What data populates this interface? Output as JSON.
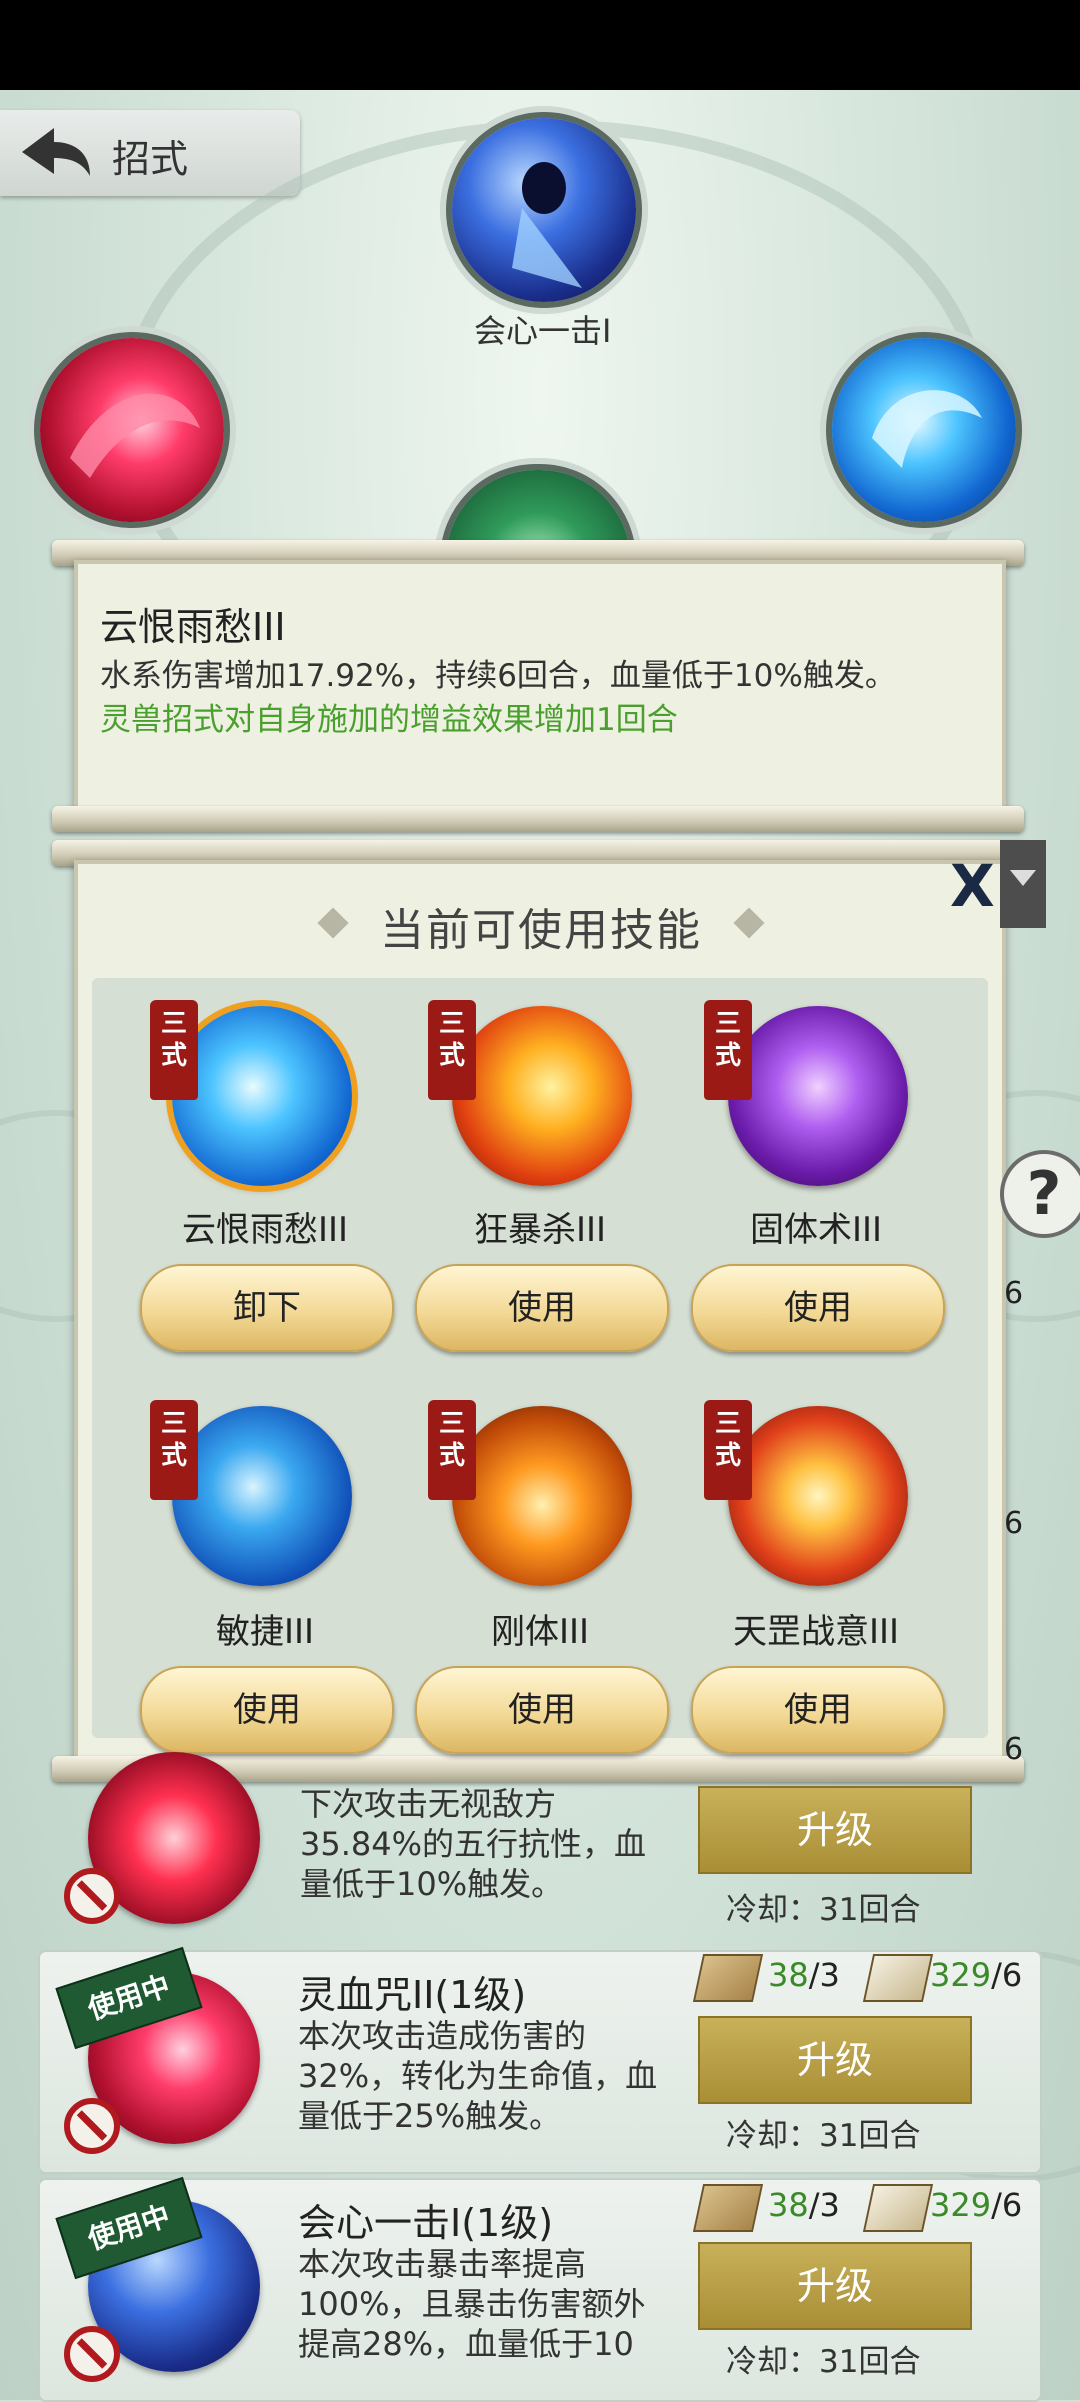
{
  "header": {
    "title": "招式"
  },
  "slots": {
    "top_label": "会心一击I"
  },
  "info": {
    "title": "云恨雨愁III",
    "desc": "水系伤害增加17.92%，持续6回合，血量低于10%触发。",
    "bonus": "灵兽招式对自身施加的增益效果增加1回合"
  },
  "skills_panel": {
    "title": "当前可使用技能",
    "close": "X",
    "badge": "三式",
    "skills": [
      {
        "name": "云恨雨愁III",
        "button": "卸下",
        "color": "#2a8be0"
      },
      {
        "name": "狂暴杀III",
        "button": "使用",
        "color": "#e8651a"
      },
      {
        "name": "固体术III",
        "button": "使用",
        "color": "#9a3ad8"
      },
      {
        "name": "敏捷III",
        "button": "使用",
        "color": "#1f7fd8"
      },
      {
        "name": "刚体III",
        "button": "使用",
        "color": "#e07b16"
      },
      {
        "name": "天罡战意III",
        "button": "使用",
        "color": "#e0401a"
      }
    ]
  },
  "list": {
    "in_use": "使用中",
    "upgrade": "升级",
    "cards": [
      {
        "partial_count": "6"
      },
      {
        "partial_count": "6"
      },
      {
        "partial_count": "6",
        "desc": "下次攻击无视敌方35.84%的五行抗性，血量低于10%触发。",
        "cooldown": "冷却：31回合"
      },
      {
        "title": "灵血咒II(1级)",
        "desc": "本次攻击造成伤害的32%，转化为生命值，血量低于25%触发。",
        "res1": "38",
        "res1_max": "/3",
        "res2": "329",
        "res2_max": "/6",
        "cooldown": "冷却：31回合"
      },
      {
        "title": "会心一击I(1级)",
        "desc": "本次攻击暴击率提高100%，且暴击伤害额外提高28%，血量低于10",
        "res1": "38",
        "res1_max": "/3",
        "res2": "329",
        "res2_max": "/6",
        "cooldown": "冷却：31回合"
      }
    ]
  }
}
